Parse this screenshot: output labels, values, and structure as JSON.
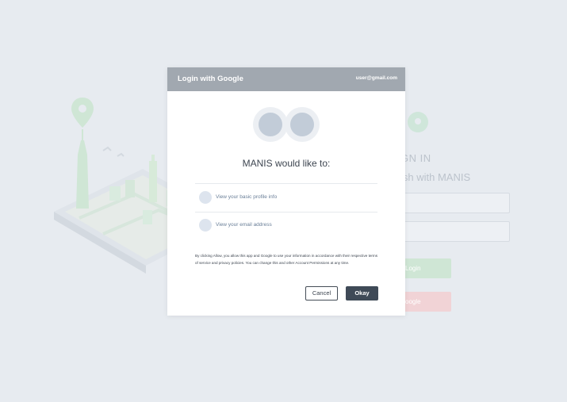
{
  "background": {
    "heading": "GN IN",
    "subheading": "ish with MANIS",
    "login_button": "Login",
    "google_button": "oogle"
  },
  "modal": {
    "title": "Login with Google",
    "account_email": "user@gmail.com",
    "prompt": "MANIS would like to:",
    "permissions": [
      {
        "label": "View your basic profile info"
      },
      {
        "label": "View your email address"
      }
    ],
    "disclaimer": "By clicking Allow, you allow this app and Google to use your information in accordance with their respective terms of service and privacy policies. You can change this and other Account Permissions at any time.",
    "cancel_label": "Cancel",
    "okay_label": "Okay"
  },
  "icons": {
    "map": "map-illustration-icon",
    "pin": "location-pin-icon",
    "avatar": "avatar-icon",
    "permission": "permission-icon"
  },
  "colors": {
    "header_bg": "#a1a8b0",
    "primary_button": "#3f4a57",
    "page_bg": "#e7ebf0",
    "accent_green": "#cfe6d5",
    "accent_red": "#f1d3d6"
  }
}
